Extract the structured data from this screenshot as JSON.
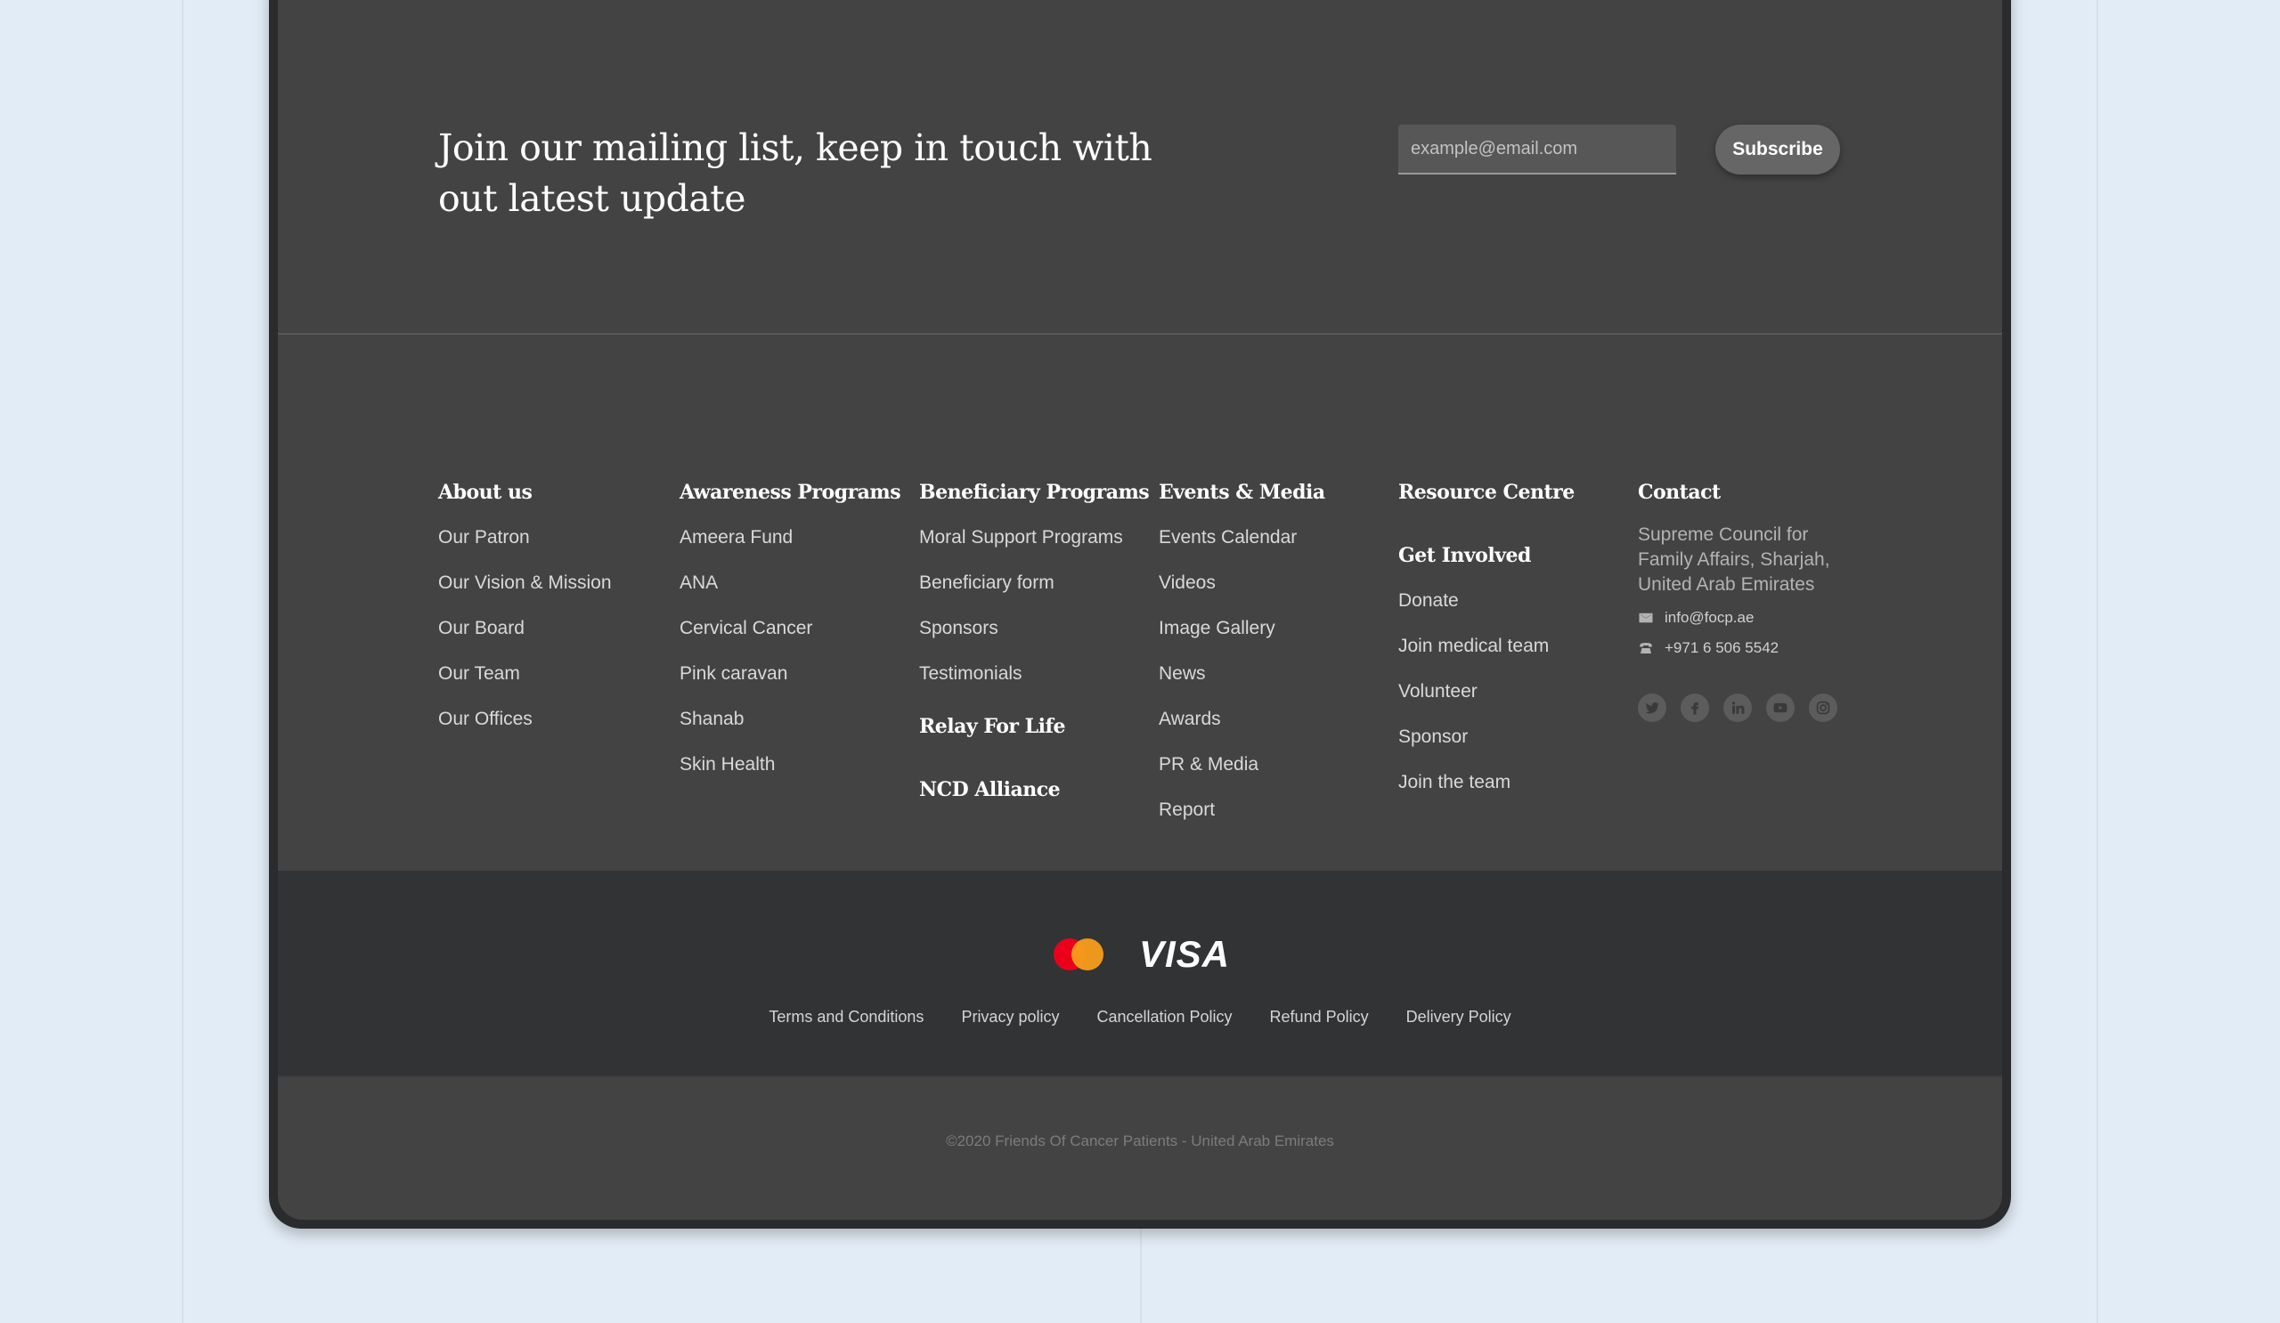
{
  "mailing": {
    "heading": "Join our mailing list, keep in touch with out latest update",
    "email_placeholder": "example@email.com",
    "subscribe_label": "Subscribe"
  },
  "columns": {
    "about": {
      "heading": "About us",
      "items": [
        "Our Patron",
        "Our Vision & Mission",
        "Our Board",
        "Our Team",
        "Our Offices"
      ]
    },
    "awareness": {
      "heading": "Awareness Programs",
      "items": [
        "Ameera Fund",
        "ANA",
        "Cervical Cancer",
        "Pink caravan",
        "Shanab",
        "Skin Health"
      ]
    },
    "beneficiary": {
      "heading": "Beneficiary Programs",
      "items": [
        "Moral Support Programs",
        "Beneficiary form",
        "Sponsors",
        "Testimonials"
      ],
      "relay": "Relay For Life",
      "ncd": "NCD Alliance"
    },
    "events": {
      "heading": "Events & Media",
      "items": [
        "Events Calendar",
        "Videos",
        "Image Gallery",
        "News",
        "Awards",
        "PR & Media",
        "Report"
      ]
    },
    "resource": {
      "heading": "Resource Centre",
      "involved_heading": "Get Involved",
      "items": [
        "Donate",
        "Join medical team",
        "Volunteer",
        "Sponsor",
        "Join the team"
      ]
    },
    "contact": {
      "heading": "Contact",
      "address": "Supreme Council for Family Affairs, Sharjah, United Arab Emirates",
      "email": "info@focp.ae",
      "phone": "+971 6 506 5542",
      "socials": [
        "twitter-icon",
        "facebook-icon",
        "linkedin-icon",
        "youtube-icon",
        "instagram-icon"
      ]
    }
  },
  "payments": {
    "visa_label": "VISA",
    "mastercard_colors": [
      "#eb001b",
      "#f79e1b"
    ]
  },
  "policies": [
    "Terms and Conditions",
    "Privacy policy",
    "Cancellation Policy",
    "Refund Policy",
    "Delivery Policy"
  ],
  "copyright": "©2020 Friends Of Cancer Patients - United Arab Emirates",
  "colors": {
    "panel": "#434344",
    "bottom_bar": "#323335",
    "page_bg": "#e2ecf6"
  }
}
